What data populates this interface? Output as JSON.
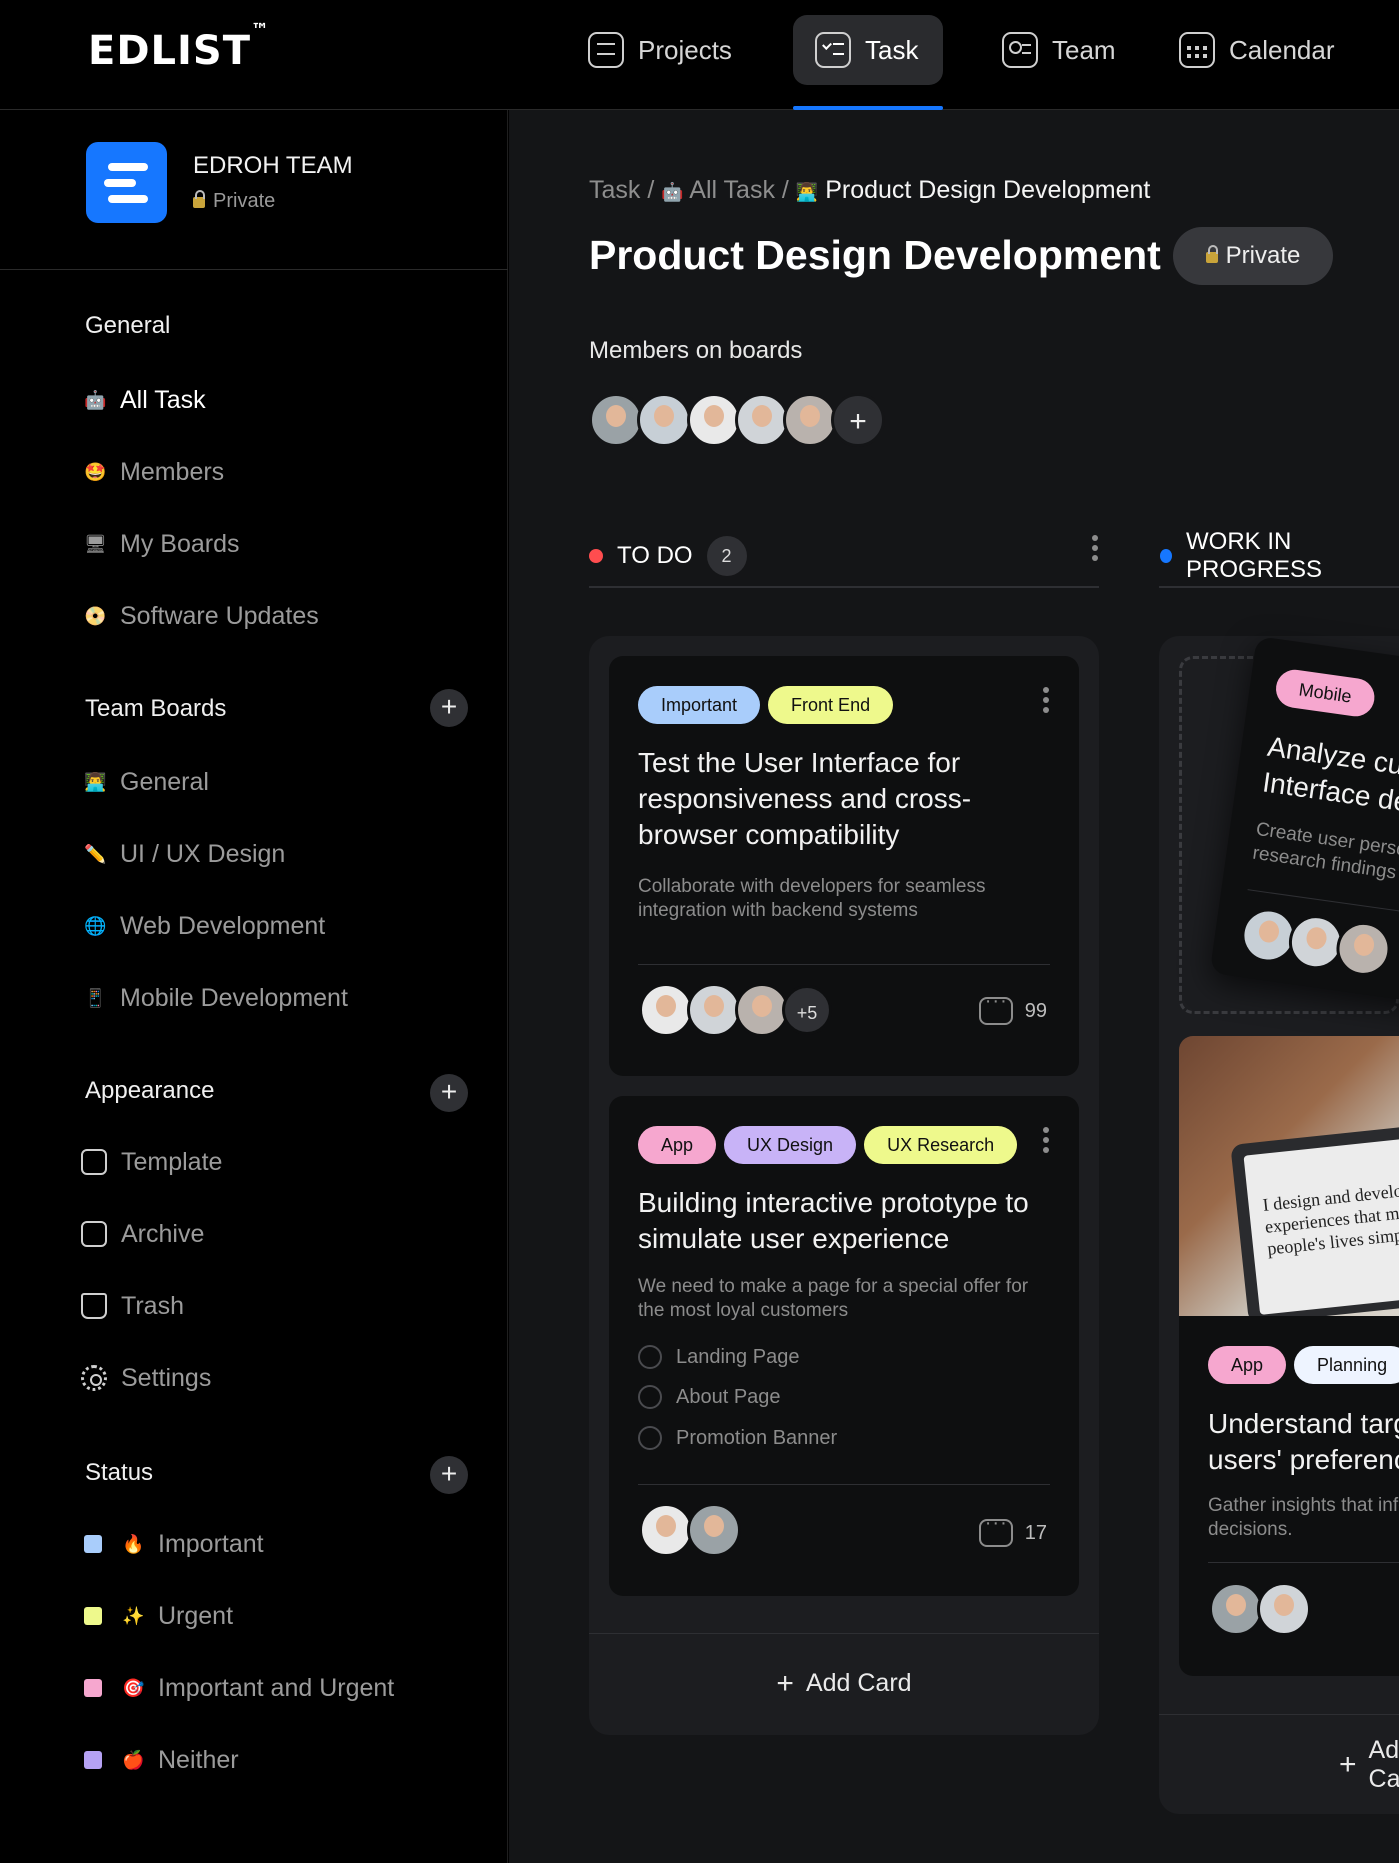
{
  "app": {
    "logo": "EDLIST",
    "logo_mark": "™"
  },
  "nav": [
    {
      "label": "Projects",
      "icon": "projects-icon",
      "active": false
    },
    {
      "label": "Task",
      "icon": "task-icon",
      "active": true
    },
    {
      "label": "Team",
      "icon": "team-icon",
      "active": false
    },
    {
      "label": "Calendar",
      "icon": "calendar-icon",
      "active": false
    }
  ],
  "team": {
    "name": "EDROH TEAM",
    "visibility": "Private"
  },
  "sidebar": {
    "general_title": "General",
    "general": [
      {
        "label": "All Task",
        "icon": "🤖"
      },
      {
        "label": "Members",
        "icon": "🤩"
      },
      {
        "label": "My Boards",
        "icon": "🖥"
      },
      {
        "label": "Software Updates",
        "icon": "📀"
      }
    ],
    "team_boards_title": "Team Boards",
    "team_boards": [
      {
        "label": "General",
        "icon": "👨‍💻"
      },
      {
        "label": "UI / UX Design",
        "icon": "✏️"
      },
      {
        "label": "Web Development",
        "icon": "🌐"
      },
      {
        "label": "Mobile Development",
        "icon": "📱"
      }
    ],
    "appearance_title": "Appearance",
    "appearance": [
      {
        "label": "Template",
        "icon": "template-icon"
      },
      {
        "label": "Archive",
        "icon": "archive-icon"
      },
      {
        "label": "Trash",
        "icon": "trash-icon"
      },
      {
        "label": "Settings",
        "icon": "settings-icon"
      }
    ],
    "status_title": "Status",
    "status": [
      {
        "label": "Important",
        "icon": "🔥",
        "color": "#a9cdfb"
      },
      {
        "label": "Urgent",
        "icon": "✨",
        "color": "#eef98c"
      },
      {
        "label": "Important and Urgent",
        "icon": "🎯",
        "color": "#f6a7cf"
      },
      {
        "label": "Neither",
        "icon": "🍎",
        "color": "#b6a2f4"
      }
    ]
  },
  "main": {
    "breadcrumb": [
      "Task",
      "All Task",
      "Product Design Development"
    ],
    "breadcrumb_sep": "/",
    "title": "Product Design Development",
    "visibility_badge": "Private",
    "members_label": "Members on boards",
    "add_member": "+"
  },
  "columns": [
    {
      "title": "TO DO",
      "count": "2",
      "dot_color": "#ff4d4f",
      "cards": [
        {
          "tags": [
            {
              "label": "Important",
              "color": "#a9cdfb"
            },
            {
              "label": "Front End",
              "color": "#eef98c"
            }
          ],
          "title": "Test the User Interface for responsiveness and cross-browser compatibility",
          "description": "Collaborate with developers for seamless integration with backend systems",
          "extra_members": "+5",
          "comments": "99"
        },
        {
          "tags": [
            {
              "label": "App",
              "color": "#f6a7cf"
            },
            {
              "label": "UX Design",
              "color": "#c8b3f7"
            },
            {
              "label": "UX Research",
              "color": "#eef98c"
            }
          ],
          "title": "Building interactive prototype to simulate user experience",
          "description": "We need to make a page for a special offer for the most loyal customers",
          "checklist": [
            "Landing Page",
            "About Page",
            "Promotion Banner"
          ],
          "comments": "17"
        }
      ],
      "add_label": "Add Card"
    },
    {
      "title": "WORK IN PROGRESS",
      "dot_color": "#1677ff",
      "drag_card": {
        "tags": [
          {
            "label": "Mobile",
            "color": "#f6a7cf"
          }
        ],
        "title": "Analyze current User Interface design",
        "description": "Create user persona based on research findings"
      },
      "photo_text": "I design and develop experiences that make people's lives simple",
      "card": {
        "tags": [
          {
            "label": "App",
            "color": "#f6a7cf"
          },
          {
            "label": "Planning",
            "color": "#eef4ff"
          }
        ],
        "title": "Understand target users' preferences, and",
        "description": "Gather insights that inform design decisions."
      },
      "add_label": "Add Card"
    }
  ]
}
